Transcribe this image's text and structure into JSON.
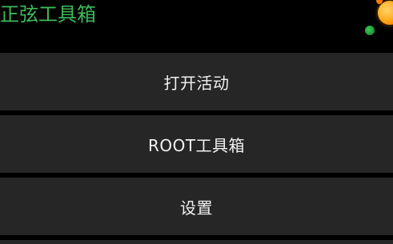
{
  "app": {
    "title": "正弦工具箱"
  },
  "colors": {
    "accent": "#3dbb59",
    "background": "#000000",
    "button_bg": "#262626",
    "button_text": "#f2f2f2"
  },
  "menu": {
    "items": [
      {
        "label": "打开活动"
      },
      {
        "label": "ROOT工具箱"
      },
      {
        "label": "设置"
      }
    ]
  }
}
